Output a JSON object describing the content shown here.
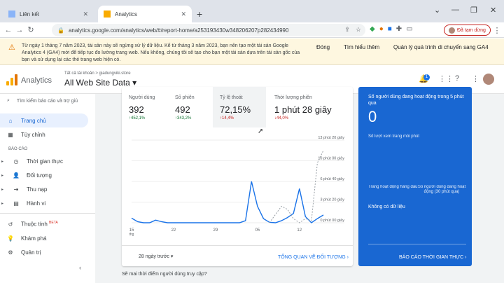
{
  "tabs": [
    {
      "title": "Liên kết"
    },
    {
      "title": "Analytics"
    }
  ],
  "browser": {
    "url": "analytics.google.com/analytics/web/#/report-home/a253193430w348206207p282434990",
    "paused": "Đã tạm dừng"
  },
  "banner": {
    "message": "Từ ngày 1 tháng 7 năm 2023, tài sản này sẽ ngừng xử lý dữ liệu. Kể từ tháng 3 năm 2023, bạn nên tạo một tài sản Google Analytics 4 (GA4) mới để tiếp tục đo lường trang web. Nếu không, chúng tôi sẽ tạo cho bạn một tài sản dựa trên tài sản gốc của bạn và sử dụng lại các thẻ trang web hiện có.",
    "close": "Đóng",
    "learn": "Tìm hiểu thêm",
    "manage": "Quản lý quá trình di chuyển sang GA4"
  },
  "header": {
    "brand": "Analytics",
    "breadcrumb": "Tất cả tài khoản > giadungviki.store",
    "property": "All Web Site Data"
  },
  "sidebar": {
    "search": "Tìm kiếm báo cáo và trợ giú",
    "home": "Trang chủ",
    "custom": "Tùy chỉnh",
    "section": "BÁO CÁO",
    "reports": [
      "Thời gian thực",
      "Đối tượng",
      "Thu nạp",
      "Hành vi"
    ],
    "attribution": "Thuộc tính",
    "beta": "BETA",
    "explore": "Khám phá",
    "admin": "Quản trị"
  },
  "metrics": [
    {
      "label": "Người dùng",
      "value": "392",
      "delta": "↑452,1%",
      "dir": "up"
    },
    {
      "label": "Số phiên",
      "value": "492",
      "delta": "↑343,2%",
      "dir": "up"
    },
    {
      "label": "Tỷ lệ thoát",
      "value": "72,15%",
      "delta": "↑14,4%",
      "dir": "down"
    },
    {
      "label": "Thời lượng phiên",
      "value": "1 phút 28 giây",
      "delta": "↓44,0%",
      "dir": "down"
    }
  ],
  "chart_data": {
    "type": "line",
    "x_ticks": [
      "15\nthg",
      "22",
      "29",
      "05",
      "12"
    ],
    "y_ticks": [
      "13 phút 20 giây",
      "10 phút 00 giây",
      "6 phút 40 giây",
      "3 phút 20 giây",
      "0 phút 00 giây"
    ],
    "ylim": [
      0,
      800
    ],
    "series": [
      {
        "values": [
          45,
          10,
          0,
          0,
          25,
          10,
          0,
          0,
          0,
          0,
          0,
          0,
          0,
          0,
          0,
          0,
          0,
          0,
          0,
          20,
          400,
          160,
          40,
          5,
          0,
          20,
          50,
          90,
          330,
          60,
          0,
          40,
          75
        ]
      },
      {
        "values": [
          null,
          null,
          null,
          null,
          null,
          null,
          null,
          null,
          null,
          null,
          null,
          null,
          null,
          null,
          null,
          null,
          null,
          null,
          null,
          null,
          null,
          null,
          null,
          0,
          80,
          160,
          130,
          40,
          0,
          40,
          20,
          580,
          700
        ]
      }
    ]
  },
  "card_footer": {
    "range": "28 ngày trước",
    "link": "TỔNG QUAN VỀ ĐỐI TƯỢNG"
  },
  "realtime": {
    "title": "Số người dùng đang hoạt động trong 5 phút qua",
    "value": "0",
    "sub": "Số lượt xem trang mỗi phút",
    "col1": "Trang hoạt động hàng đầu",
    "col2": "Số người dùng đang hoạt động (30 phút qua)",
    "nodata": "Không có dữ liệu",
    "link": "BÁO CÁO THỜI GIAN THỰC"
  },
  "peek": "Sẽ mai thời điểm người dùng truy cập?"
}
